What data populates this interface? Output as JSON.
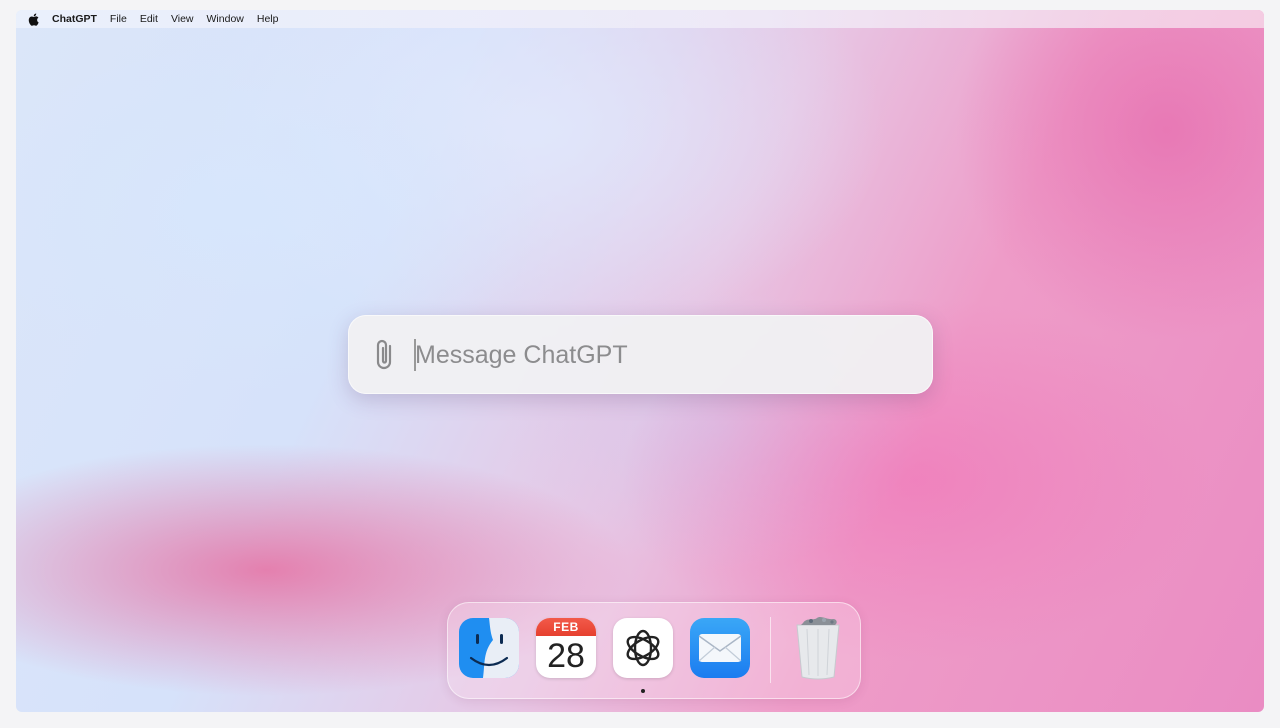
{
  "menubar": {
    "apple_icon": "apple-icon",
    "app_name": "ChatGPT",
    "items": [
      "File",
      "Edit",
      "View",
      "Window",
      "Help"
    ]
  },
  "prompt": {
    "attach_icon": "paperclip-icon",
    "placeholder": "Message ChatGPT",
    "value": ""
  },
  "dock": {
    "apps": [
      {
        "name": "Finder",
        "icon": "finder-icon"
      },
      {
        "name": "Calendar",
        "icon": "calendar-icon",
        "month": "FEB",
        "day": "28"
      },
      {
        "name": "ChatGPT",
        "icon": "chatgpt-icon",
        "running": true
      },
      {
        "name": "Mail",
        "icon": "mail-icon"
      },
      {
        "name": "Trash",
        "icon": "trash-icon"
      }
    ]
  },
  "colors": {
    "calendar_header": "#e6402f",
    "mail_blue": "#1b7cf0",
    "finder_blue": "#1f8ef1"
  }
}
